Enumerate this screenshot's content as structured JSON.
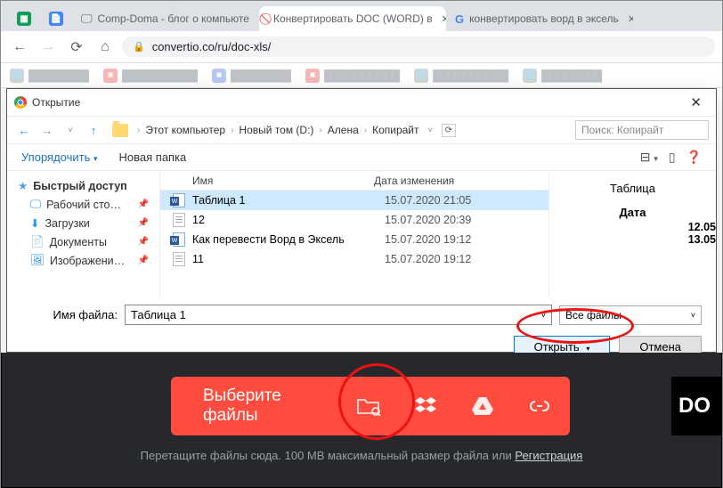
{
  "tabs": [
    {
      "label": ""
    },
    {
      "label": ""
    },
    {
      "label": "Comp-Doma - блог о компьюте"
    },
    {
      "label": "Конвертировать DOC (WORD) в"
    },
    {
      "label": "конвертировать ворд в эксель"
    }
  ],
  "url": "convertio.co/ru/doc-xls/",
  "dialog": {
    "title": "Открытие",
    "crumbs": [
      "Этот компьютер",
      "Новый том (D:)",
      "Алена",
      "Копирайт"
    ],
    "search_ph": "Поиск: Копирайт",
    "organize": "Упорядочить",
    "newfolder": "Новая папка",
    "sidebar": [
      "Быстрый доступ",
      "Рабочий сто…",
      "Загрузки",
      "Документы",
      "Изображени…"
    ],
    "cols": {
      "name": "Имя",
      "date": "Дата изменения"
    },
    "files": [
      {
        "name": "Таблица 1",
        "date": "15.07.2020 21:05",
        "type": "word"
      },
      {
        "name": "12",
        "date": "15.07.2020 20:39",
        "type": "txt"
      },
      {
        "name": "Как перевести Ворд в Эксель",
        "date": "15.07.2020 19:12",
        "type": "word"
      },
      {
        "name": "11",
        "date": "15.07.2020 19:12",
        "type": "txt"
      }
    ],
    "preview": {
      "line1": "Таблица",
      "line2": "Дата",
      "d1": "12.05",
      "d2": "13.05"
    },
    "filename_label": "Имя файла:",
    "filename": "Таблица 1",
    "filetype": "Все файлы",
    "open": "Открыть",
    "cancel": "Отмена"
  },
  "page": {
    "choose": "Выберите файлы",
    "tagline_a": "Перетащите файлы сюда. 100 MB максимальный размер файла или ",
    "tagline_b": "Регистрация",
    "do": "DO"
  }
}
